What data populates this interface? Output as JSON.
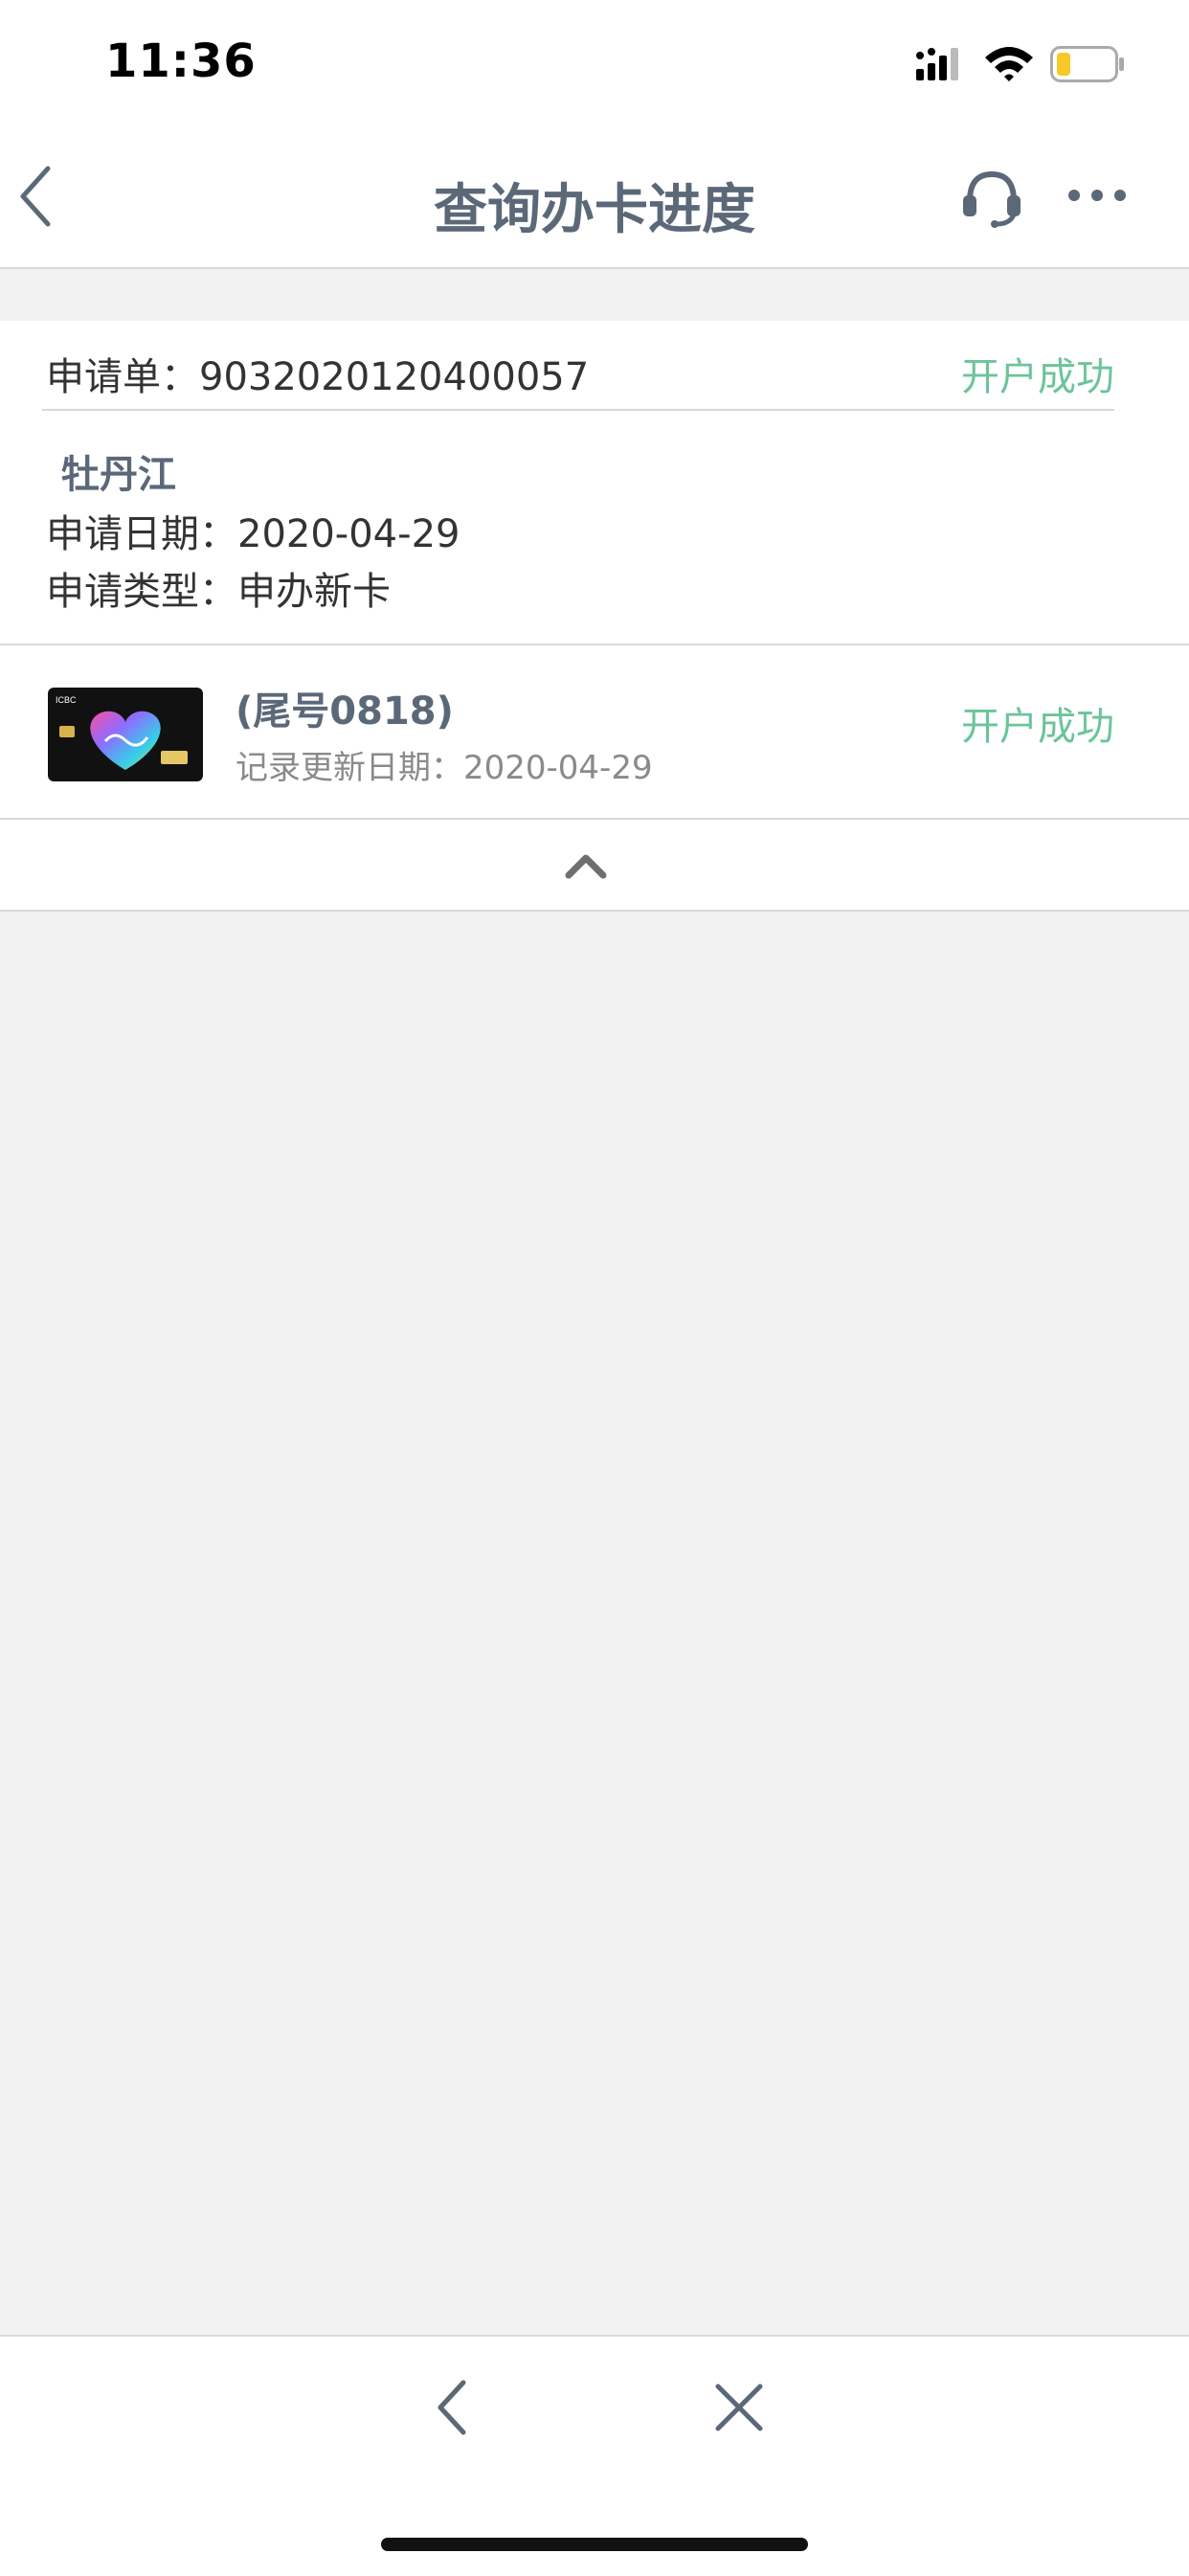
{
  "status_bar": {
    "time": "11:36",
    "icons": [
      "signal-icon",
      "wifi-icon",
      "battery-icon"
    ]
  },
  "nav": {
    "title": "查询办卡进度",
    "icons": [
      "back-icon",
      "headset-icon",
      "more-icon"
    ]
  },
  "application": {
    "number_label": "申请单：",
    "number": "9032020120400057",
    "status": "开户成功",
    "city": "牡丹江",
    "date_label": "申请日期：",
    "date": "2020-04-29",
    "type_label": "申请类型：",
    "type": "申办新卡"
  },
  "card": {
    "tail": "(尾号0818)",
    "update_label": "记录更新日期：",
    "update_date": "2020-04-29",
    "status": "开户成功",
    "brand_text": "ICBC"
  },
  "collapse": {
    "icon": "chevron-up-icon"
  },
  "bottom_bar": {
    "icons": [
      "back-icon",
      "close-icon"
    ]
  },
  "colors": {
    "accent_title": "#5b6878",
    "success": "#6cc49a",
    "background": "#f2f2f2",
    "separator": "#d9d9d9"
  }
}
